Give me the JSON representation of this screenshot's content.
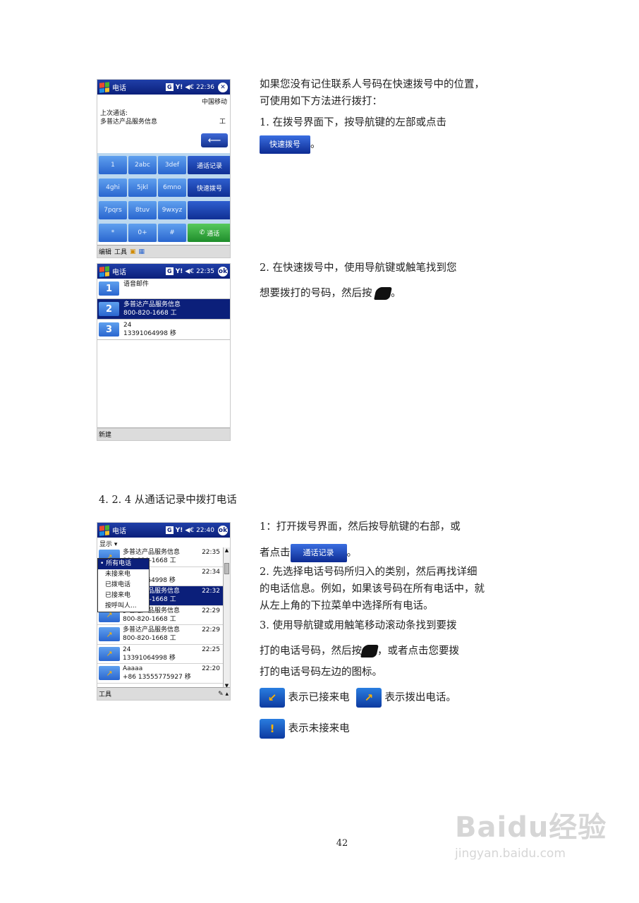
{
  "phone_dial": {
    "title": "电话",
    "time": "22:36",
    "g_badge": "G",
    "carrier": "中国移动",
    "last_call_label": "上次通话:",
    "last_call_name": "多普达产品服务信息",
    "last_call_type": "工",
    "keys": [
      "1",
      "2abc",
      "3def",
      "通话记录",
      "4ghi",
      "5jkl",
      "6mno",
      "快速拨号",
      "7pqrs",
      "8tuv",
      "9wxyz",
      "",
      "*",
      "0+",
      "#",
      "通话"
    ],
    "menu": [
      "编辑",
      "工具"
    ]
  },
  "phone_speed": {
    "title": "电话",
    "time": "22:35",
    "g_badge": "G",
    "rows": [
      {
        "num": "1",
        "line1": "语音邮件",
        "line2": ""
      },
      {
        "num": "2",
        "line1": "多普达产品服务信息",
        "line2": "800-820-1668 工"
      },
      {
        "num": "3",
        "line1": "24",
        "line2": "13391064998 移"
      }
    ],
    "menu": [
      "新建"
    ]
  },
  "phone_log": {
    "title": "电话",
    "time": "22:40",
    "g_badge": "G",
    "show_label": "显示",
    "dropdown": [
      "所有电话",
      "未接来电",
      "已拨电话",
      "已接来电",
      "按呼叫人..."
    ],
    "rows": [
      {
        "line1": "多普达产品服务信息",
        "line2": "800-820-1668 工",
        "time": "22:35"
      },
      {
        "line1": "24",
        "line2": "13391064998 移",
        "time": "22:34"
      },
      {
        "line1": "多普达产品服务信息",
        "line2": "800-820-1668 工",
        "time": "22:32"
      },
      {
        "line1": "多普达产品服务信息",
        "line2": "800-820-1668 工",
        "time": "22:29"
      },
      {
        "line1": "多普达产品服务信息",
        "line2": "800-820-1668 工",
        "time": "22:29"
      },
      {
        "line1": "24",
        "line2": "13391064998 移",
        "time": "22:25"
      },
      {
        "line1": "Aaaaa",
        "line2": "+86 13555775927 移",
        "time": "22:20"
      }
    ],
    "menu": [
      "工具"
    ]
  },
  "text": {
    "p1": "如果您没有记住联系人号码在快速拨号中的位置，可使用如下方法进行拨打：",
    "p2": "1. 在拨号界面下，按导航键的左部或点击",
    "btn_speed": "快速拨号",
    "p2_end": "。",
    "p3a": "2. 在快速拨号中，使用导航键或触笔找到您",
    "p3b": "想要拨打的号码，然后按",
    "p3_end": "。",
    "heading": "4. 2. 4 从通话记录中拨打电话",
    "q1a": "1：打开拨号界面，然后按导航键的右部，或",
    "q1b": "者点击",
    "btn_log": "通话记录",
    "q1_end": "。",
    "q2": "2. 先选择电话号码所归入的类别，然后再找详细的电话信息。例如，如果该号码在所有电话中，就从左上角的下拉菜单中选择所有电话。",
    "q3a": "3. 使用导航键或用触笔移动滚动条找到要拨",
    "q3b": "打的电话号码，然后按",
    "q3c": "，或者点击您要拨",
    "q3d": "打的电话号码左边的图标。",
    "legend_received": "表示已接来电",
    "legend_dialed": "表示拨出电话。",
    "legend_missed": "表示未接来电"
  },
  "page_number": "42",
  "watermark": {
    "line1": "Baidu经验",
    "line2": "jingyan.baidu.com"
  }
}
